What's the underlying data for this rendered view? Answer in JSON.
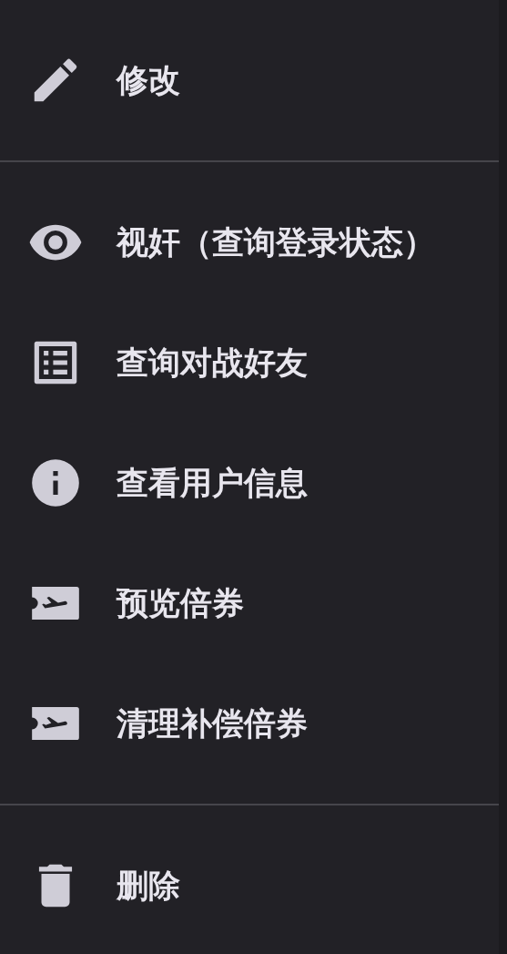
{
  "menu": {
    "sections": [
      {
        "items": [
          {
            "kind": "edit",
            "label": "修改"
          }
        ]
      },
      {
        "items": [
          {
            "kind": "view",
            "label": "视奸（查询登录状态）"
          },
          {
            "kind": "list",
            "label": "查询对战好友"
          },
          {
            "kind": "info",
            "label": "查看用户信息"
          },
          {
            "kind": "ticket",
            "label": "预览倍券"
          },
          {
            "kind": "ticket",
            "label": "清理补偿倍券"
          }
        ]
      },
      {
        "items": [
          {
            "kind": "delete",
            "label": "删除"
          }
        ]
      }
    ]
  }
}
